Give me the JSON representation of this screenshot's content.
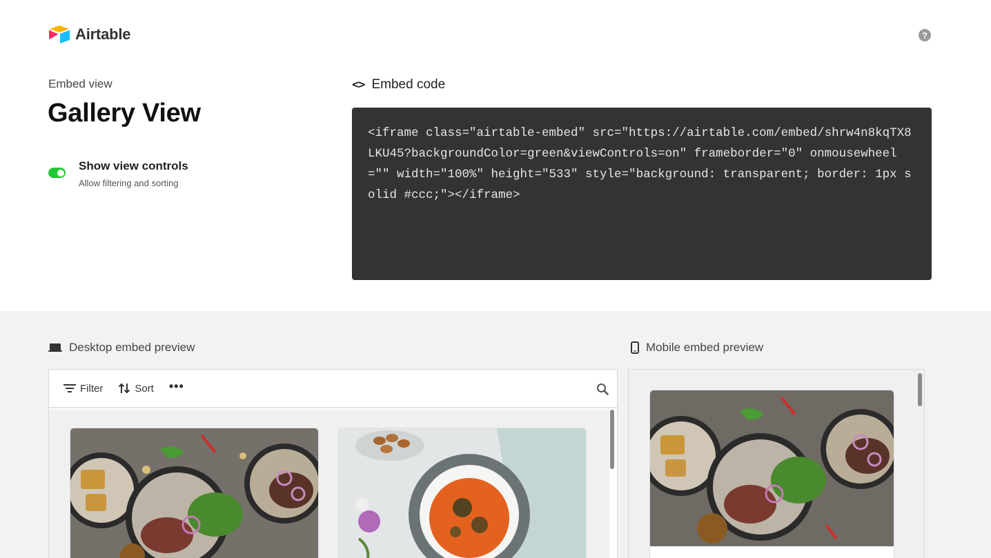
{
  "app": {
    "name": "Airtable"
  },
  "header": {
    "help_icon": "help-icon",
    "help_glyph": "?"
  },
  "embed": {
    "label": "Embed view",
    "title": "Gallery View",
    "toggle": {
      "label": "Show view controls",
      "sublabel": "Allow filtering and sorting",
      "on": true,
      "color": "#20c933"
    }
  },
  "code": {
    "label": "Embed code",
    "icon_glyph": "<>",
    "snippet": "<iframe class=\"airtable-embed\" src=\"https://airtable.com/embed/shrw4n8kqTX8LKU45?backgroundColor=green&viewControls=on\" frameborder=\"0\" onmousewheel=\"\" width=\"100%\" height=\"533\" style=\"background: transparent; border: 1px solid #ccc;\"></iframe>"
  },
  "preview": {
    "desktop_label": "Desktop embed preview",
    "mobile_label": "Mobile embed preview",
    "toolbar": {
      "filter": "Filter",
      "sort": "Sort",
      "more": "•••"
    }
  },
  "colors": {
    "accent_green": "#20c933",
    "code_bg": "#333333",
    "preview_bg": "#f2f2f2"
  }
}
